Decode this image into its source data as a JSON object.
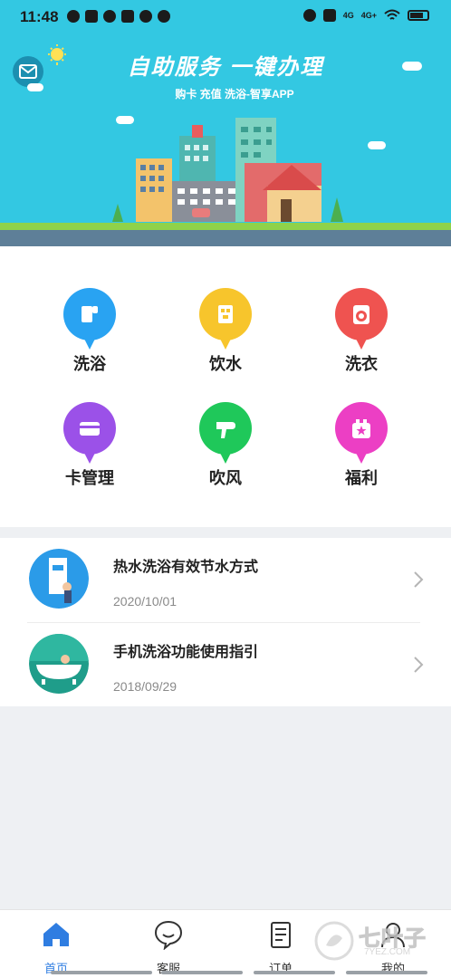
{
  "status_bar": {
    "time": "11:48",
    "network_1": "4G",
    "network_2": "4G+",
    "battery_label": "74"
  },
  "header": {
    "title": "自助服务  一键办理",
    "subtitle": "购卡 充值 洗浴-智享APP",
    "mail_icon": "mail-icon",
    "accent_color": "#33c8e2"
  },
  "services": [
    {
      "label": "洗浴",
      "icon": "shower-icon",
      "color": "#29a3f2"
    },
    {
      "label": "饮水",
      "icon": "water-dispenser-icon",
      "color": "#f7c52c"
    },
    {
      "label": "洗衣",
      "icon": "washing-machine-icon",
      "color": "#ef5350"
    },
    {
      "label": "卡管理",
      "icon": "card-icon",
      "color": "#9b51e8"
    },
    {
      "label": "吹风",
      "icon": "hair-dryer-icon",
      "color": "#1fc85a"
    },
    {
      "label": "福利",
      "icon": "gift-icon",
      "color": "#ec3fc4"
    }
  ],
  "articles": [
    {
      "title": "热水洗浴有效节水方式",
      "date": "2020/10/01"
    },
    {
      "title": "手机洗浴功能使用指引",
      "date": "2018/09/29"
    }
  ],
  "bottom_nav": [
    {
      "label": "首页",
      "icon": "home-icon",
      "active": true
    },
    {
      "label": "客服",
      "icon": "chat-icon",
      "active": false
    },
    {
      "label": "订单",
      "icon": "order-icon",
      "active": false
    },
    {
      "label": "我的",
      "icon": "profile-icon",
      "active": false
    }
  ],
  "watermark": {
    "text": "七叶子",
    "sub": "7YEZ.COM"
  }
}
